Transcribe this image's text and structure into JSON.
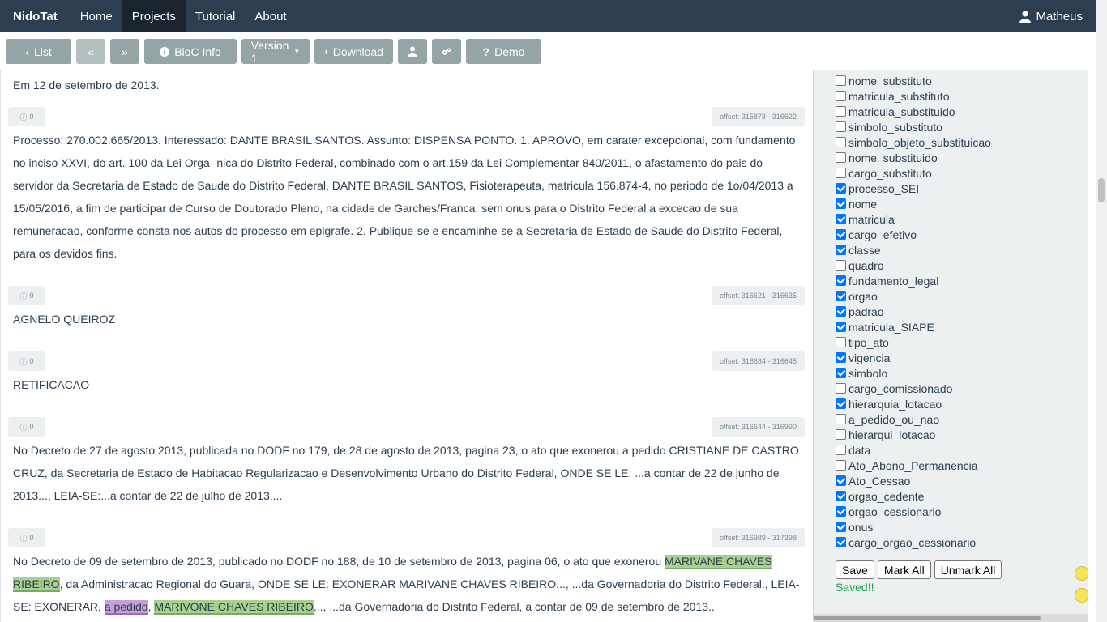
{
  "navbar": {
    "brand": "NidoTat",
    "items": [
      "Home",
      "Projects",
      "Tutorial",
      "About"
    ],
    "active": "Projects",
    "user": "Matheus"
  },
  "toolbar": {
    "list_label": "List",
    "bioc_label": "BioC Info",
    "version_label": "Version 1",
    "download_label": "Download",
    "demo_label": "Demo"
  },
  "passages": [
    {
      "text": "Em 12 de setembro de 2013."
    },
    {
      "count": "0",
      "offset": "offset: 315878 - 316622",
      "text": "Processo: 270.002.665/2013. Interessado: DANTE BRASIL SANTOS. Assunto: DISPENSA PONTO. 1. APROVO, em carater excepcional, com fundamento no inciso XXVI, do art. 100 da Lei Orga- nica do Distrito Federal, combinado com o art.159 da Lei Complementar 840/2011, o afastamento do pais do servidor da Secretaria de Estado de Saude do Distrito Federal, DANTE BRASIL SANTOS, Fisioterapeuta, matricula 156.874-4, no periodo de 1o/04/2013 a 15/05/2016, a fim de participar de Curso de Doutorado Pleno, na cidade de Garches/Franca, sem onus para o Distrito Federal a excecao de sua remuneracao, conforme consta nos autos do processo em epigrafe. 2. Publique-se e encaminhe-se a Secretaria de Estado de Saude do Distrito Federal, para os devidos fins."
    },
    {
      "count": "0",
      "offset": "offset: 316621 - 316635",
      "text": "AGNELO QUEIROZ"
    },
    {
      "count": "0",
      "offset": "offset: 316634 - 316645",
      "text": "RETIFICACAO"
    },
    {
      "count": "0",
      "offset": "offset: 316644 - 316990",
      "text": "No Decreto de 27 de agosto 2013, publicada no DODF no 179, de 28 de agosto de 2013, pagina 23, o ato que exonerou a pedido CRISTIANE DE CASTRO CRUZ, da Secretaria de Estado de Habitacao Regularizacao e Desenvolvimento Urbano do Distrito Federal, ONDE SE LE: ...a contar de 22 de junho de 2013..., LEIA-SE:...a contar de 22 de julho de 2013...."
    },
    {
      "count": "0",
      "offset": "offset: 316989 - 317398",
      "seg1": "No Decreto de 09 de setembro de 2013, publicado no DODF no 188, de 10 de setembro de 2013, pagina 06, o ato que exonerou ",
      "hl1": "MARIVANE CHAVES RIBEIRO",
      "seg2": ", da Administracao Regional do Guara, ONDE SE LE: EXONERAR MARIVANE CHAVES RIBEIRO..., ...da Governadoria do Distrito Federal., LEIA-SE: EXONERAR, ",
      "hl2": "a pedido",
      "seg3": ", ",
      "hl3": "MARIVONE CHAVES RIBEIRO",
      "seg4": "..., ...da Governadoria do Distrito Federal, a contar de 09 de setembro de 2013.."
    }
  ],
  "checkboxes": [
    {
      "label": "nome_substituto",
      "checked": false
    },
    {
      "label": "matricula_substituto",
      "checked": false
    },
    {
      "label": "matricula_substituido",
      "checked": false
    },
    {
      "label": "simbolo_substituto",
      "checked": false
    },
    {
      "label": "simbolo_objeto_substituicao",
      "checked": false
    },
    {
      "label": "nome_substituido",
      "checked": false
    },
    {
      "label": "cargo_substituto",
      "checked": false
    },
    {
      "label": "processo_SEI",
      "checked": true
    },
    {
      "label": "nome",
      "checked": true
    },
    {
      "label": "matricula",
      "checked": true
    },
    {
      "label": "cargo_efetivo",
      "checked": true
    },
    {
      "label": "classe",
      "checked": true
    },
    {
      "label": "quadro",
      "checked": false
    },
    {
      "label": "fundamento_legal",
      "checked": true
    },
    {
      "label": "orgao",
      "checked": true
    },
    {
      "label": "padrao",
      "checked": true
    },
    {
      "label": "matricula_SIAPE",
      "checked": true
    },
    {
      "label": "tipo_ato",
      "checked": false
    },
    {
      "label": "vigencia",
      "checked": true
    },
    {
      "label": "simbolo",
      "checked": true
    },
    {
      "label": "cargo_comissionado",
      "checked": false
    },
    {
      "label": "hierarquia_lotacao",
      "checked": true
    },
    {
      "label": "a_pedido_ou_nao",
      "checked": false
    },
    {
      "label": "hierarqui_lotacao",
      "checked": false
    },
    {
      "label": "data",
      "checked": false
    },
    {
      "label": "Ato_Abono_Permanencia",
      "checked": false
    },
    {
      "label": "Ato_Cessao",
      "checked": true
    },
    {
      "label": "orgao_cedente",
      "checked": true
    },
    {
      "label": "orgao_cessionario",
      "checked": true
    },
    {
      "label": "onus",
      "checked": true
    },
    {
      "label": "cargo_orgao_cessionario",
      "checked": true
    }
  ],
  "panel": {
    "save_label": "Save",
    "mark_all_label": "Mark All",
    "unmark_all_label": "Unmark All",
    "status": "Saved!!"
  },
  "colors": {
    "navbar": "#2c3e50",
    "button": "#95a5a6",
    "highlight_green": "#a9d18e",
    "highlight_purple": "#c7a0d8",
    "saved": "#18a14b"
  }
}
